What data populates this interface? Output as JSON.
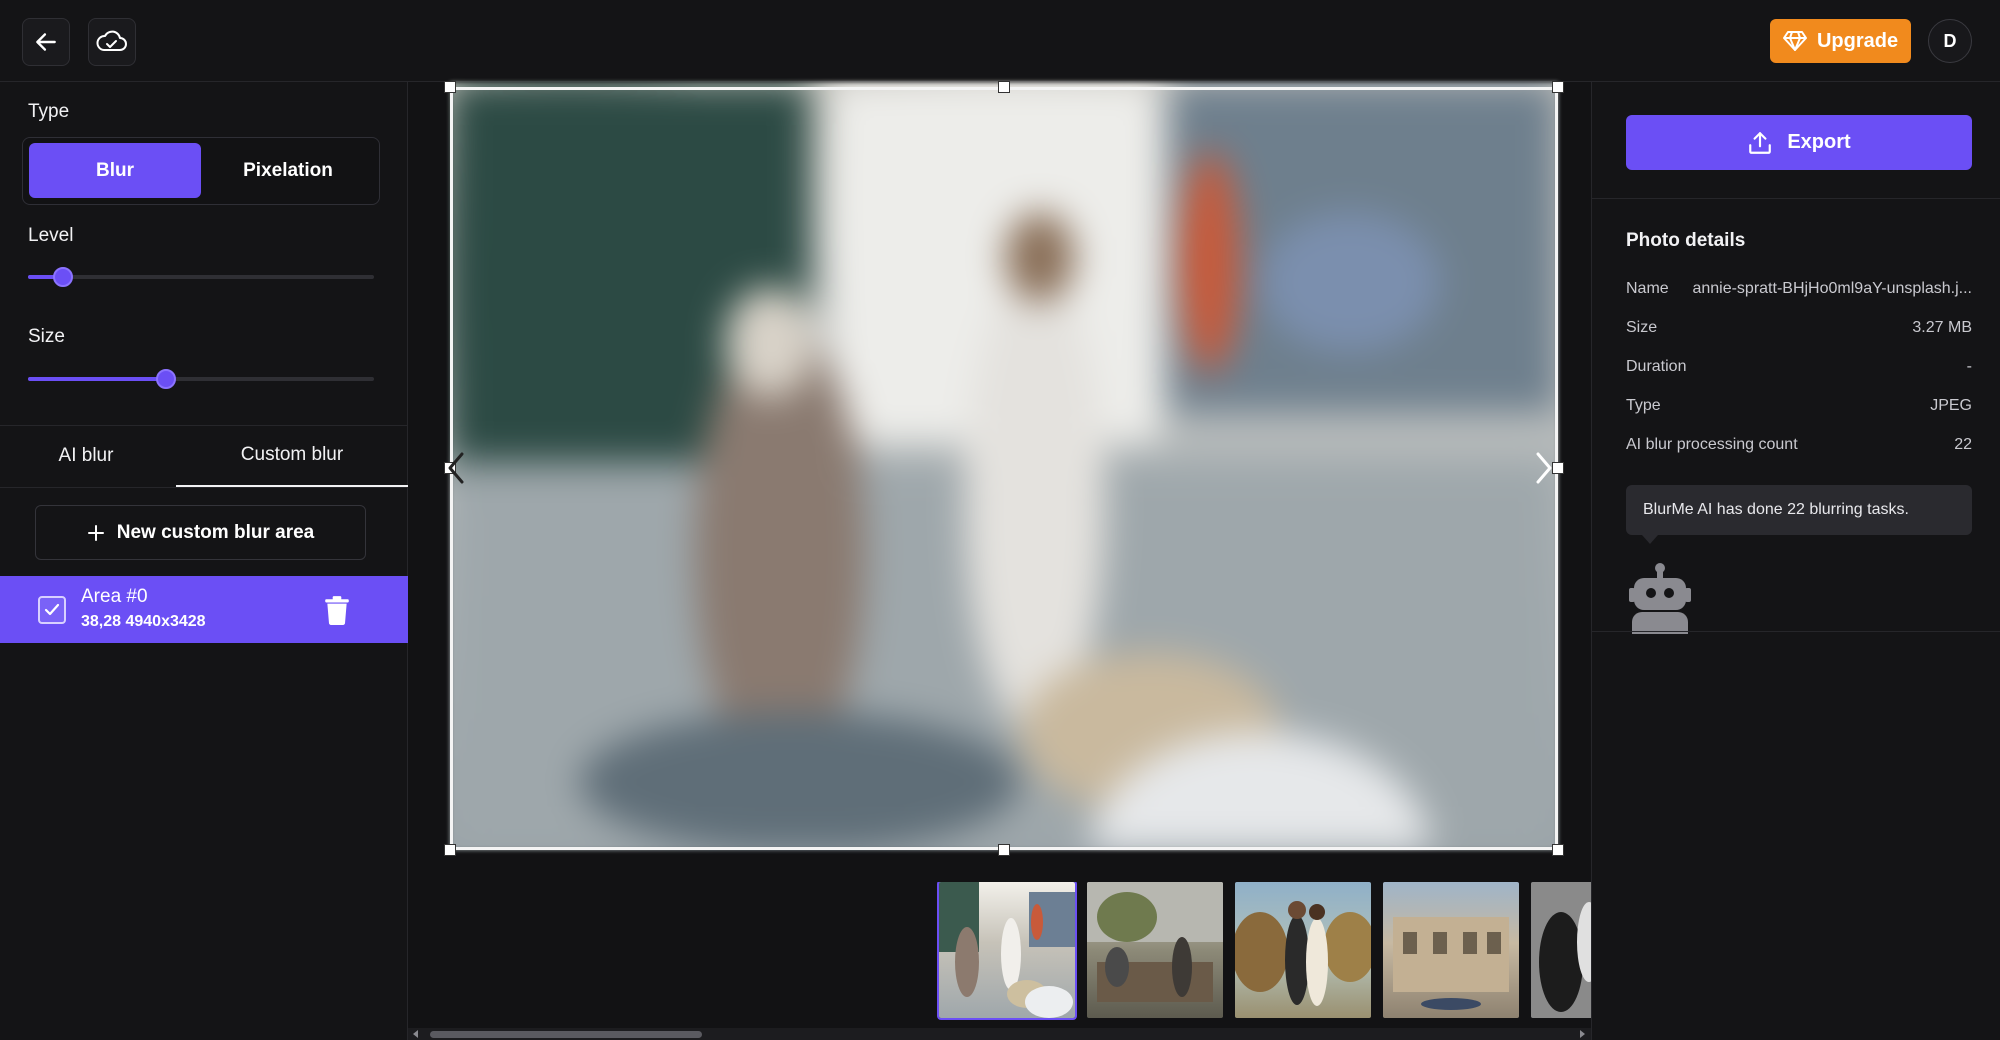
{
  "topbar": {
    "back_icon": "arrow-left-icon",
    "cloud_icon": "cloud-check-icon",
    "upgrade_label": "Upgrade",
    "upgrade_icon": "diamond-icon",
    "avatar_initial": "D",
    "accent_color": "#f18a1d"
  },
  "left_panel": {
    "type_label": "Type",
    "type_options": [
      "Blur",
      "Pixelation"
    ],
    "type_selected": "Blur",
    "level_label": "Level",
    "level_value": 0.1,
    "size_label": "Size",
    "size_value": 0.4,
    "tabs": [
      "AI blur",
      "Custom blur"
    ],
    "active_tab": "Custom blur",
    "new_area_label": "New custom blur area",
    "areas": [
      {
        "name": "Area #0",
        "meta": "38,28 4940x3428",
        "checked": true
      }
    ],
    "accent_color": "#6b4ff5"
  },
  "canvas": {
    "prev_icon": "chevron-left-icon",
    "next_icon": "chevron-right-icon",
    "thumbnail_count": 5,
    "selected_thumbnail": 0
  },
  "right_panel": {
    "export_label": "Export",
    "export_icon": "upload-icon",
    "details_title": "Photo details",
    "details": [
      {
        "label": "Name",
        "value": "annie-spratt-BHjHo0ml9aY-unsplash.j..."
      },
      {
        "label": "Size",
        "value": "3.27 MB"
      },
      {
        "label": "Duration",
        "value": "-"
      },
      {
        "label": "Type",
        "value": "JPEG"
      },
      {
        "label": "AI blur processing count",
        "value": "22"
      }
    ],
    "bubble_text": "BlurMe AI has done 22 blurring tasks.",
    "robot_icon": "robot-icon"
  }
}
